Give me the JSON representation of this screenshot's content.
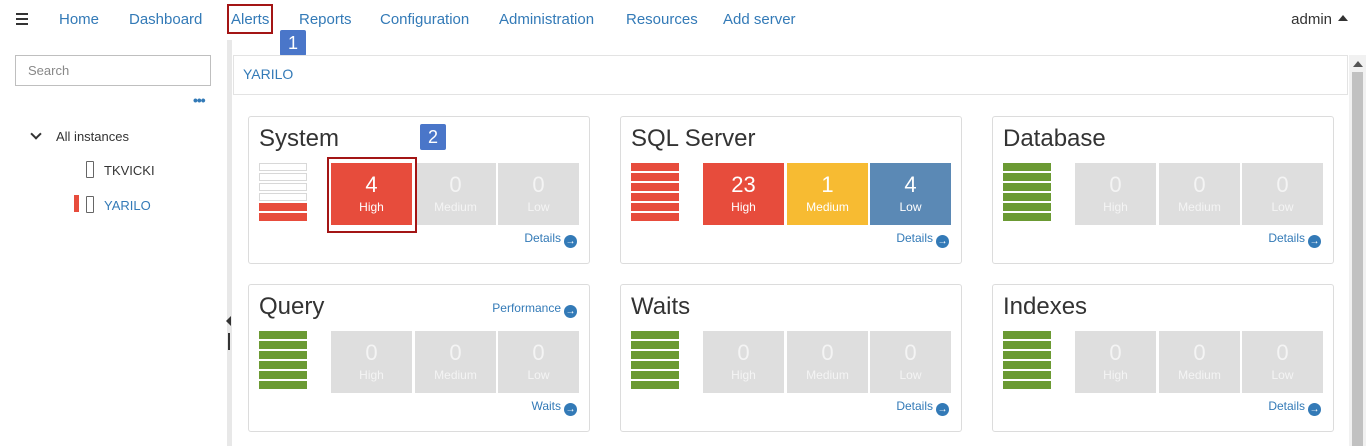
{
  "nav": {
    "items": [
      "Home",
      "Dashboard",
      "Alerts",
      "Reports",
      "Configuration",
      "Administration",
      "Resources",
      "Add server"
    ],
    "user": "admin"
  },
  "callouts": [
    "1",
    "2"
  ],
  "sidebar": {
    "search_placeholder": "Search",
    "more": "•••",
    "tree_root": "All instances",
    "instances": [
      "TKVICKI",
      "YARILO"
    ],
    "selected": "YARILO"
  },
  "breadcrumb": "YARILO",
  "colors": {
    "high": "#e74c3c",
    "medium": "#f7bb32",
    "low": "#5b89b5",
    "ok": "#6b9a33",
    "link": "#337ab7",
    "highlight": "#a31515"
  },
  "cards": [
    {
      "title": "System",
      "status": "high",
      "high": "4",
      "medium": "0",
      "low": "0",
      "link": "Details",
      "filled_red": 2
    },
    {
      "title": "SQL Server",
      "status": "high",
      "high": "23",
      "medium": "1",
      "low": "4",
      "link": "Details",
      "filled_red": 6
    },
    {
      "title": "Database",
      "status": "ok",
      "high": "0",
      "medium": "0",
      "low": "0",
      "link": "Details"
    },
    {
      "title": "Query",
      "status": "ok",
      "high": "0",
      "medium": "0",
      "low": "0",
      "link": "Waits",
      "extra_link": "Performance"
    },
    {
      "title": "Waits",
      "status": "ok",
      "high": "0",
      "medium": "0",
      "low": "0",
      "link": "Details"
    },
    {
      "title": "Indexes",
      "status": "ok",
      "high": "0",
      "medium": "0",
      "low": "0",
      "link": "Details"
    }
  ],
  "labels": {
    "high": "High",
    "medium": "Medium",
    "low": "Low"
  }
}
